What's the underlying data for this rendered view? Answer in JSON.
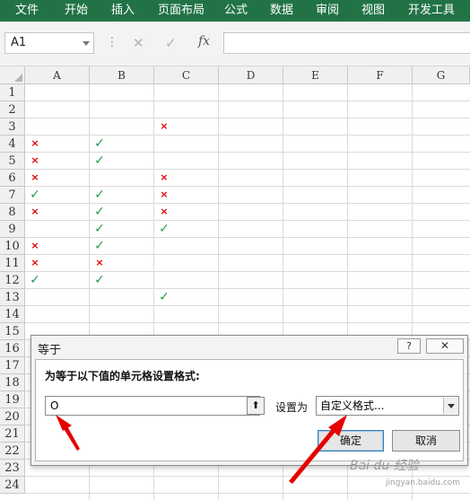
{
  "ribbon": {
    "tabs": [
      "文件",
      "开始",
      "插入",
      "页面布局",
      "公式",
      "数据",
      "审阅",
      "视图",
      "开发工具"
    ],
    "bg_color": "#217346"
  },
  "formula_bar": {
    "name_box": "A1",
    "cancel_icon": "✕",
    "enter_icon": "✓",
    "fx_label": "fx",
    "formula": ""
  },
  "sheet": {
    "columns": [
      "A",
      "B",
      "C",
      "D",
      "E",
      "F",
      "G"
    ],
    "rows": [
      "1",
      "2",
      "3",
      "4",
      "5",
      "6",
      "7",
      "8",
      "9",
      "10",
      "11",
      "12",
      "13",
      "14",
      "15",
      "16",
      "17",
      "18",
      "19",
      "20",
      "21",
      "22",
      "23",
      "24"
    ],
    "cells": [
      {
        "row": 3,
        "col": "C",
        "symbol": "×",
        "kind": "cross"
      },
      {
        "row": 4,
        "col": "A",
        "symbol": "×",
        "kind": "cross"
      },
      {
        "row": 4,
        "col": "B",
        "symbol": "✓",
        "kind": "check"
      },
      {
        "row": 5,
        "col": "A",
        "symbol": "×",
        "kind": "cross"
      },
      {
        "row": 5,
        "col": "B",
        "symbol": "✓",
        "kind": "check"
      },
      {
        "row": 6,
        "col": "A",
        "symbol": "×",
        "kind": "cross"
      },
      {
        "row": 6,
        "col": "C",
        "symbol": "×",
        "kind": "cross"
      },
      {
        "row": 7,
        "col": "A",
        "symbol": "✓",
        "kind": "check"
      },
      {
        "row": 7,
        "col": "B",
        "symbol": "✓",
        "kind": "check"
      },
      {
        "row": 7,
        "col": "C",
        "symbol": "×",
        "kind": "cross"
      },
      {
        "row": 8,
        "col": "A",
        "symbol": "×",
        "kind": "cross"
      },
      {
        "row": 8,
        "col": "B",
        "symbol": "✓",
        "kind": "check"
      },
      {
        "row": 8,
        "col": "C",
        "symbol": "×",
        "kind": "cross"
      },
      {
        "row": 9,
        "col": "B",
        "symbol": "✓",
        "kind": "check"
      },
      {
        "row": 9,
        "col": "C",
        "symbol": "✓",
        "kind": "check"
      },
      {
        "row": 10,
        "col": "A",
        "symbol": "×",
        "kind": "cross"
      },
      {
        "row": 10,
        "col": "B",
        "symbol": "✓",
        "kind": "check"
      },
      {
        "row": 11,
        "col": "A",
        "symbol": "×",
        "kind": "cross"
      },
      {
        "row": 11,
        "col": "B",
        "symbol": "×",
        "kind": "cross"
      },
      {
        "row": 12,
        "col": "A",
        "symbol": "✓",
        "kind": "check"
      },
      {
        "row": 12,
        "col": "B",
        "symbol": "✓",
        "kind": "check"
      },
      {
        "row": 13,
        "col": "C",
        "symbol": "✓",
        "kind": "check"
      }
    ],
    "cross_color": "#e00000",
    "check_color": "#1f9e4a"
  },
  "dialog": {
    "title": "等于",
    "help": "?",
    "close": "✕",
    "prompt": "为等于以下值的单元格设置格式:",
    "value": "O",
    "picker_icon": "⬆",
    "set_as_label": "设置为",
    "format_selected": "自定义格式...",
    "ok": "确定",
    "cancel": "取消"
  },
  "watermark": {
    "text": "Bai du 经验",
    "url": "jingyan.baidu.com"
  }
}
